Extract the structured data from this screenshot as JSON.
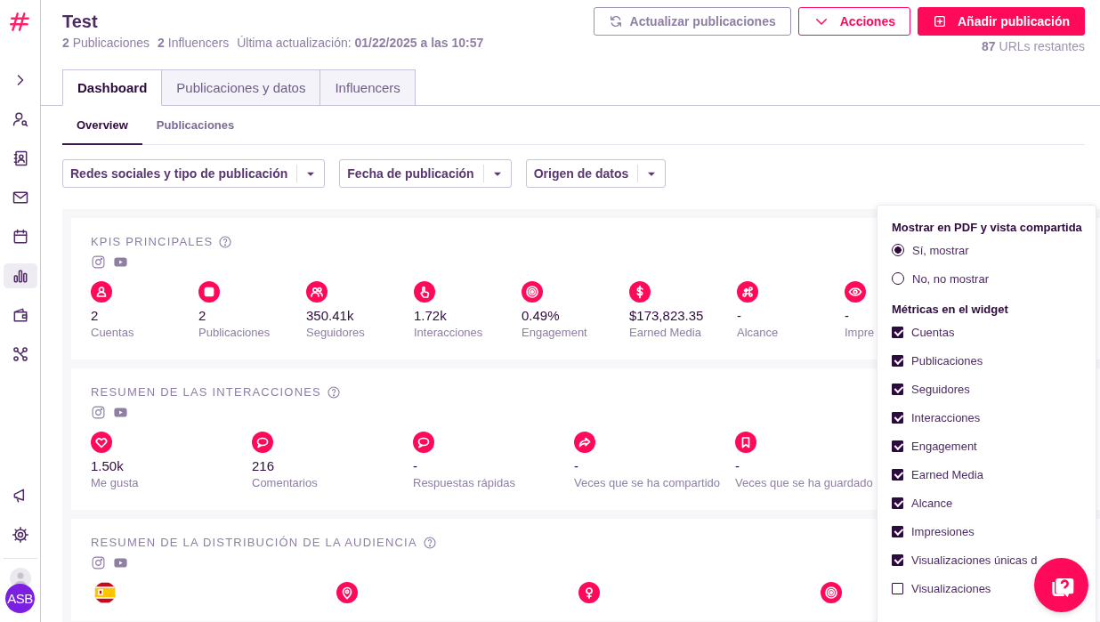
{
  "sidebar": {
    "nav_items": [
      {
        "selected": false
      },
      {
        "selected": false
      },
      {
        "selected": false
      },
      {
        "selected": false
      },
      {
        "selected": false
      },
      {
        "selected": true
      },
      {
        "selected": false
      },
      {
        "selected": false
      }
    ],
    "bottom_items": [
      {
        "selected": false
      },
      {
        "selected": false
      }
    ],
    "avatar": {
      "initials": "ASB"
    }
  },
  "header": {
    "title": "Test",
    "stats": [
      "**2** Publicaciones",
      "**2** Influencers",
      "Última actualización: **01/22/2025 a las 10:57**"
    ],
    "buttons": [
      {
        "kind": "refresh",
        "label": "Actualizar publicaciones"
      },
      {
        "kind": "dropdown",
        "label": "Acciones"
      },
      {
        "kind": "add",
        "label": "Añadir publicación"
      }
    ],
    "urls_remaining": "**87** URLs restantes"
  },
  "tabs": [
    {
      "label": "Dashboard",
      "selected": true
    },
    {
      "label": "Publicaciones y datos",
      "selected": false
    },
    {
      "label": "Influencers",
      "selected": false
    }
  ],
  "subtabs": [
    {
      "label": "Overview",
      "selected": true
    },
    {
      "label": "Publicaciones",
      "selected": false
    }
  ],
  "filters": [
    "Redes sociales y tipo de publicación",
    "Fecha de publicación",
    "Origen de datos"
  ],
  "widgets": [
    {
      "title": "KPIS PRINCIPALES",
      "metrics": [
        {
          "kind": "icon",
          "value": "2",
          "label": "Cuentas"
        },
        {
          "kind": "icon",
          "value": "2",
          "label": "Publicaciones"
        },
        {
          "kind": "icon",
          "value": "350.41k",
          "label": "Seguidores"
        },
        {
          "kind": "icon",
          "value": "1.72k",
          "label": "Interacciones"
        },
        {
          "kind": "icon",
          "value": "0.49%",
          "label": "Engagement"
        },
        {
          "kind": "icon",
          "value": "$173,823.35",
          "label": "Earned Media"
        },
        {
          "kind": "icon",
          "value": "-",
          "label": "Alcance"
        },
        {
          "kind": "icon",
          "value": "-",
          "label": "Impre"
        }
      ]
    },
    {
      "title": "RESUMEN DE LAS INTERACCIONES",
      "metrics": [
        {
          "kind": "icon",
          "value": "1.50k",
          "label": "Me gusta"
        },
        {
          "kind": "icon",
          "value": "216",
          "label": "Comentarios"
        },
        {
          "kind": "icon",
          "value": "-",
          "label": "Respuestas rápidas"
        },
        {
          "kind": "icon",
          "value": "-",
          "label": "Veces que se ha compartido"
        },
        {
          "kind": "icon",
          "value": "-",
          "label": "Veces que se ha guardado"
        }
      ]
    },
    {
      "title": "RESUMEN DE LA DISTRIBUCIÓN DE LA AUDIENCIA",
      "metrics": [
        {
          "kind": "flag"
        },
        {
          "kind": "icon"
        },
        {
          "kind": "icon"
        },
        {
          "kind": "icon"
        }
      ]
    }
  ],
  "popover": {
    "title": "Mostrar en PDF y vista compartida",
    "options": [
      {
        "label": "Sí, mostrar",
        "selected": true
      },
      {
        "label": "No, no mostrar",
        "selected": false
      }
    ],
    "metrics_title": "Métricas en el widget",
    "metrics": [
      {
        "label": "Cuentas",
        "checked": true
      },
      {
        "label": "Publicaciones",
        "checked": true
      },
      {
        "label": "Seguidores",
        "checked": true
      },
      {
        "label": "Interacciones",
        "checked": true
      },
      {
        "label": "Engagement",
        "checked": true
      },
      {
        "label": "Earned Media",
        "checked": true
      },
      {
        "label": "Alcance",
        "checked": true
      },
      {
        "label": "Impresiones",
        "checked": true
      },
      {
        "label": "Visualizaciones únicas d",
        "checked": true
      },
      {
        "label": "Visualizaciones",
        "checked": false
      }
    ]
  }
}
